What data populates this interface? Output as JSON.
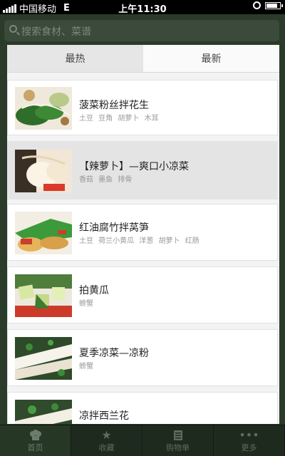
{
  "status_bar": {
    "carrier": "中国移动",
    "network": "E",
    "time": "上午11:30"
  },
  "search": {
    "placeholder": "搜索食材、菜谱"
  },
  "tabs": [
    {
      "label": "最热",
      "active": true
    },
    {
      "label": "最新",
      "active": false
    }
  ],
  "recipes": [
    {
      "title": "菠菜粉丝拌花生",
      "tags": "土豆 豆角 胡萝卜 木耳",
      "selected": false
    },
    {
      "title": "【辣萝卜】—爽口小凉菜",
      "tags": "香菇 墨鱼 排骨",
      "selected": true
    },
    {
      "title": "红油腐竹拌莴笋",
      "tags": "土豆 荷兰小黄瓜 洋葱 胡萝卜 红肠",
      "selected": false
    },
    {
      "title": "拍黄瓜",
      "tags": "螃蟹",
      "selected": false
    },
    {
      "title": "夏季凉菜—凉粉",
      "tags": "螃蟹",
      "selected": false
    },
    {
      "title": "凉拌西兰花",
      "tags": "",
      "selected": false
    }
  ],
  "bottom_tabs": [
    {
      "label": "首页",
      "icon": "chef-hat-icon"
    },
    {
      "label": "收藏",
      "icon": "star-icon"
    },
    {
      "label": "购物单",
      "icon": "list-icon"
    },
    {
      "label": "更多",
      "icon": "more-icon"
    }
  ],
  "colors": {
    "panel_bg": "#f3f3f3",
    "selected_row": "#e4e4e4",
    "overlay": "#2a3b2a"
  }
}
